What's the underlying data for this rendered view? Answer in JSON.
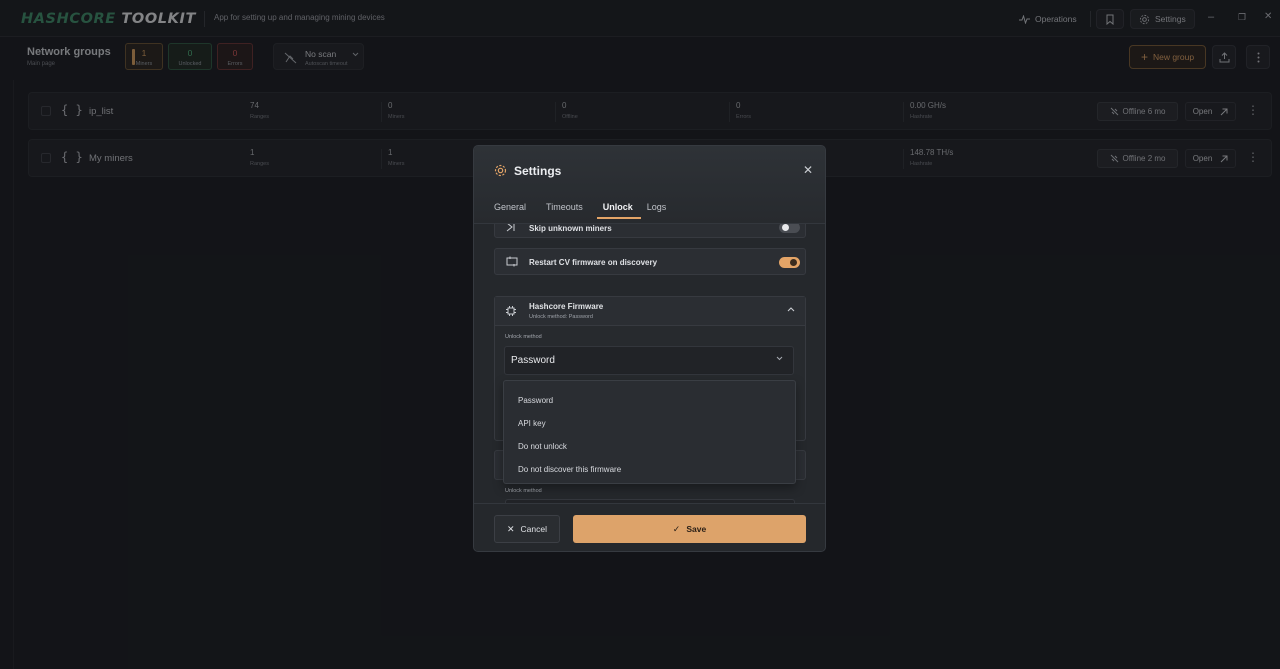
{
  "app": {
    "logo_part1": "HASHCORE",
    "logo_part2": " TOOLKIT",
    "subtitle": "App for setting up and managing mining devices",
    "operations_label": "Operations",
    "settings_label": "Settings",
    "minimize": "–",
    "restore": "❐",
    "close": "✕"
  },
  "header": {
    "title": "Network groups",
    "subtitle": "Main page",
    "stats": {
      "miners_value": "1",
      "miners_label": "Miners",
      "unlocked_value": "0",
      "unlocked_label": "Unlocked",
      "errors_value": "0",
      "errors_label": "Errors"
    },
    "scan": {
      "title": "No scan",
      "subtitle": "Autoscan timeout"
    },
    "new_group_label": "New group"
  },
  "groups": [
    {
      "name": "ip_list",
      "ranges_value": "74",
      "ranges_label": "Ranges",
      "miners_value": "0",
      "miners_label": "Miners",
      "offline_value": "0",
      "offline_label": "Offline",
      "errors_value": "0",
      "errors_label": "Errors",
      "hashrate_value": "0.00 GH/s",
      "hashrate_label": "Hashrate",
      "offline_badge": "Offline 6 mo",
      "open_label": "Open"
    },
    {
      "name": "My miners",
      "ranges_value": "1",
      "ranges_label": "Ranges",
      "miners_value": "1",
      "miners_label": "Miners",
      "hashrate_value": "148.78 TH/s",
      "hashrate_label": "Hashrate",
      "offline_badge": "Offline 2 mo",
      "open_label": "Open"
    }
  ],
  "modal": {
    "title": "Settings",
    "close": "✕",
    "tabs": [
      "General",
      "Timeouts",
      "Unlock",
      "Logs"
    ],
    "active_tab": "Unlock",
    "skip_unknown_label": "Skip unknown miners",
    "skip_unknown_on": false,
    "restart_cv_label": "Restart CV firmware on discovery",
    "restart_cv_on": true,
    "firmware_title": "Hashcore Firmware",
    "firmware_subtitle": "Unlock method: Password",
    "unlock_method_label": "Unlock method",
    "unlock_method_value": "Password",
    "second_unlock_method_label": "Unlock method",
    "dropdown_options": [
      "Password",
      "API key",
      "Do not unlock",
      "Do not discover this firmware"
    ],
    "cancel_label": "Cancel",
    "save_label": "Save"
  },
  "colors": {
    "accent": "#dda36a",
    "unlocked": "#4fb87f",
    "errors": "#d25757",
    "logo_green": "#3f8f6a"
  }
}
